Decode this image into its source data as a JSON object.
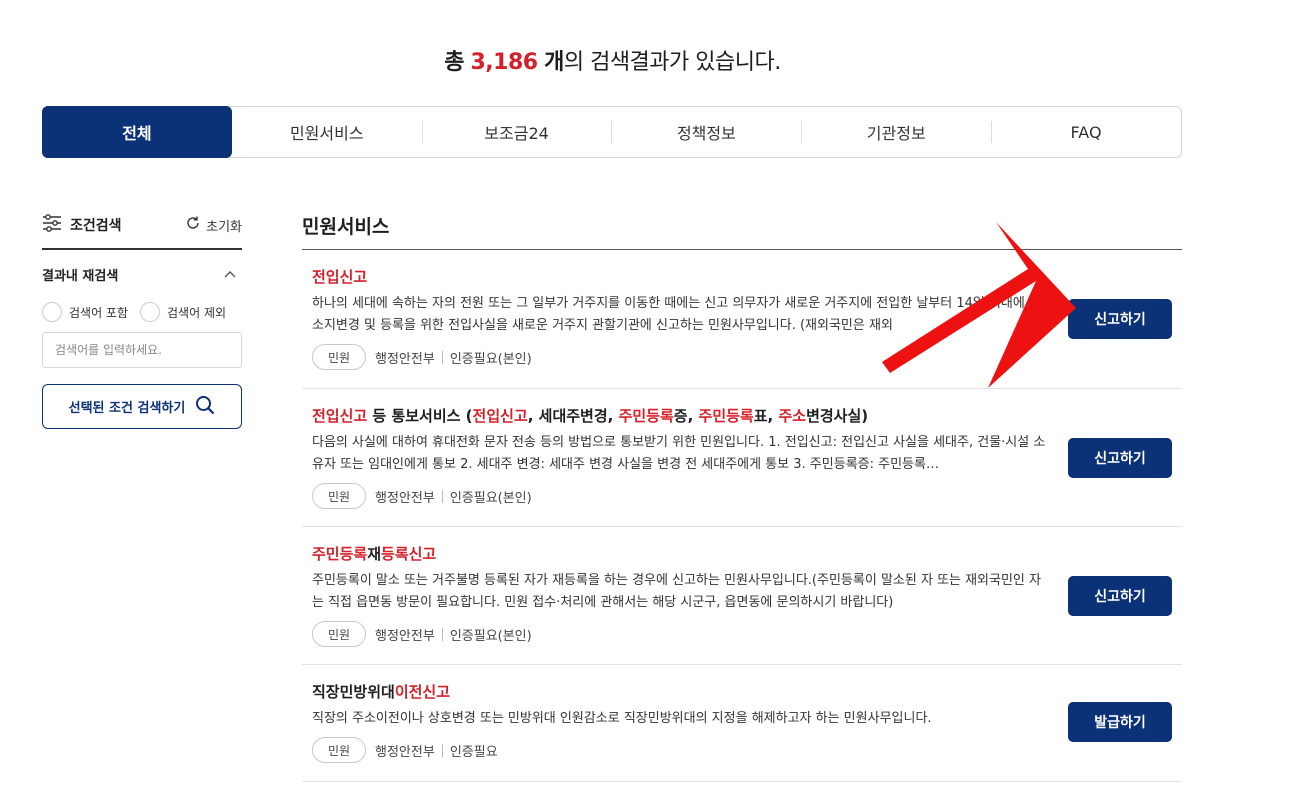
{
  "summary": {
    "prefix": "총",
    "count": "3,186",
    "unit": "개",
    "suffix": "의 검색결과가 있습니다."
  },
  "tabs": [
    {
      "label": "전체",
      "active": true
    },
    {
      "label": "민원서비스",
      "active": false
    },
    {
      "label": "보조금24",
      "active": false
    },
    {
      "label": "정책정보",
      "active": false
    },
    {
      "label": "기관정보",
      "active": false
    },
    {
      "label": "FAQ",
      "active": false
    }
  ],
  "sidebar": {
    "title": "조건검색",
    "reset_label": "초기화",
    "refine_title": "결과내 재검색",
    "include_label": "검색어 포함",
    "exclude_label": "검색어 제외",
    "search_placeholder": "검색어를 입력하세요.",
    "search_button": "선택된 조건 검색하기"
  },
  "section": {
    "title": "민원서비스"
  },
  "results": [
    {
      "title_parts": [
        {
          "text": "전입신고",
          "hl": true
        }
      ],
      "desc": "하나의 세대에 속하는 자의 전원 또는 그 일부가 거주지를 이동한 때에는 신고 의무자가 새로운 거주지에 전입한 날부터 14일 이내에 주소지변경 및 등록을 위한 전입사실을 새로운 거주지 관할기관에 신고하는 민원사무입니다. (재외국민은 재외",
      "badge": "민원",
      "agency": "행정안전부",
      "auth": "인증필요(본인)",
      "button": "신고하기"
    },
    {
      "title_parts": [
        {
          "text": "전입신고",
          "hl": true
        },
        {
          "text": " 등 통보서비스 (",
          "hl": false
        },
        {
          "text": "전입신고",
          "hl": true
        },
        {
          "text": ", 세대주변경, ",
          "hl": false
        },
        {
          "text": "주민등록",
          "hl": true
        },
        {
          "text": "증, ",
          "hl": false
        },
        {
          "text": "주민등록",
          "hl": true
        },
        {
          "text": "표, ",
          "hl": false
        },
        {
          "text": "주소",
          "hl": true
        },
        {
          "text": "변경사실)",
          "hl": false
        }
      ],
      "desc": "다음의 사실에 대하여 휴대전화 문자 전송 등의 방법으로 통보받기 위한 민원입니다. 1. 전입신고: 전입신고 사실을 세대주, 건물·시설 소유자 또는 임대인에게 통보 2. 세대주 변경: 세대주 변경 사실을 변경 전 세대주에게 통보 3. 주민등록증: 주민등록…",
      "badge": "민원",
      "agency": "행정안전부",
      "auth": "인증필요(본인)",
      "button": "신고하기"
    },
    {
      "title_parts": [
        {
          "text": "주민등록",
          "hl": true
        },
        {
          "text": "재",
          "hl": false
        },
        {
          "text": "등록신고",
          "hl": true
        }
      ],
      "desc": "주민등록이 말소 또는 거주불명 등록된 자가 재등록을 하는 경우에 신고하는 민원사무입니다.(주민등록이 말소된 자 또는 재외국민인 자는 직접 읍면동 방문이 필요합니다. 민원 접수·처리에 관해서는 해당 시군구, 읍면동에 문의하시기 바랍니다)",
      "badge": "민원",
      "agency": "행정안전부",
      "auth": "인증필요(본인)",
      "button": "신고하기"
    },
    {
      "title_parts": [
        {
          "text": "직장민방위대",
          "hl": false
        },
        {
          "text": "이전신고",
          "hl": true
        }
      ],
      "desc": "직장의 주소이전이나 상호변경 또는 민방위대 인원감소로 직장민방위대의 지정을 해제하고자 하는 민원사무입니다.",
      "badge": "민원",
      "agency": "행정안전부",
      "auth": "인증필요",
      "button": "발급하기"
    }
  ],
  "colors": {
    "primary": "#0b3276",
    "highlight": "#d5202a",
    "arrow": "#ee1111"
  },
  "icons": {
    "filter": "sliders-icon",
    "reset": "refresh-icon",
    "collapse": "chevron-up-icon",
    "search": "search-icon",
    "pointer": "red-arrow-icon"
  }
}
